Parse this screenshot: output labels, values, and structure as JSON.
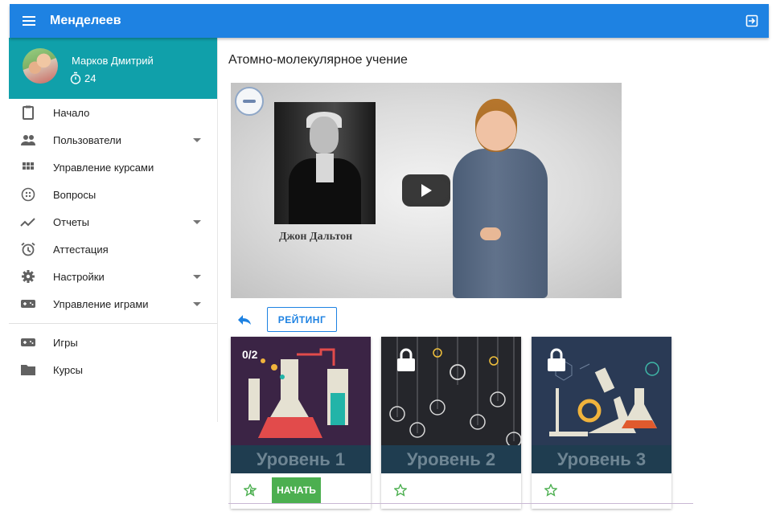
{
  "app": {
    "title": "Менделеев"
  },
  "user": {
    "name": "Марков Дмитрий",
    "score": "24"
  },
  "nav": [
    {
      "label": "Начало",
      "icon": "clipboard-icon",
      "expandable": false
    },
    {
      "label": "Пользователи",
      "icon": "people-icon",
      "expandable": true
    },
    {
      "label": "Управление курсами",
      "icon": "grid-icon",
      "expandable": false
    },
    {
      "label": "Вопросы",
      "icon": "dots-circle-icon",
      "expandable": false
    },
    {
      "label": "Отчеты",
      "icon": "trending-icon",
      "expandable": true
    },
    {
      "label": "Аттестация",
      "icon": "alarm-icon",
      "expandable": false
    },
    {
      "label": "Настройки",
      "icon": "gear-icon",
      "expandable": true
    },
    {
      "label": "Управление играми",
      "icon": "gamepad-icon",
      "expandable": true
    }
  ],
  "nav2": [
    {
      "label": "Игры",
      "icon": "gamepad-icon"
    },
    {
      "label": "Курсы",
      "icon": "folder-icon"
    }
  ],
  "page": {
    "title": "Атомно-молекулярное учение"
  },
  "video": {
    "caption": "Джон Дальтон"
  },
  "actions": {
    "rating": "РЕЙТИНГ"
  },
  "levels": [
    {
      "title": "Уровень 1",
      "progress": "0/2",
      "locked": false,
      "start": "НАЧАТЬ",
      "color": "#3b2445"
    },
    {
      "title": "Уровень 2",
      "locked": true,
      "color": "#25262b"
    },
    {
      "title": "Уровень 3",
      "locked": true,
      "color": "#2a3a55"
    }
  ],
  "colors": {
    "primary": "#1e82e2",
    "profile": "#10a0aa",
    "success": "#4caf50",
    "banner": "#1f3d50"
  }
}
